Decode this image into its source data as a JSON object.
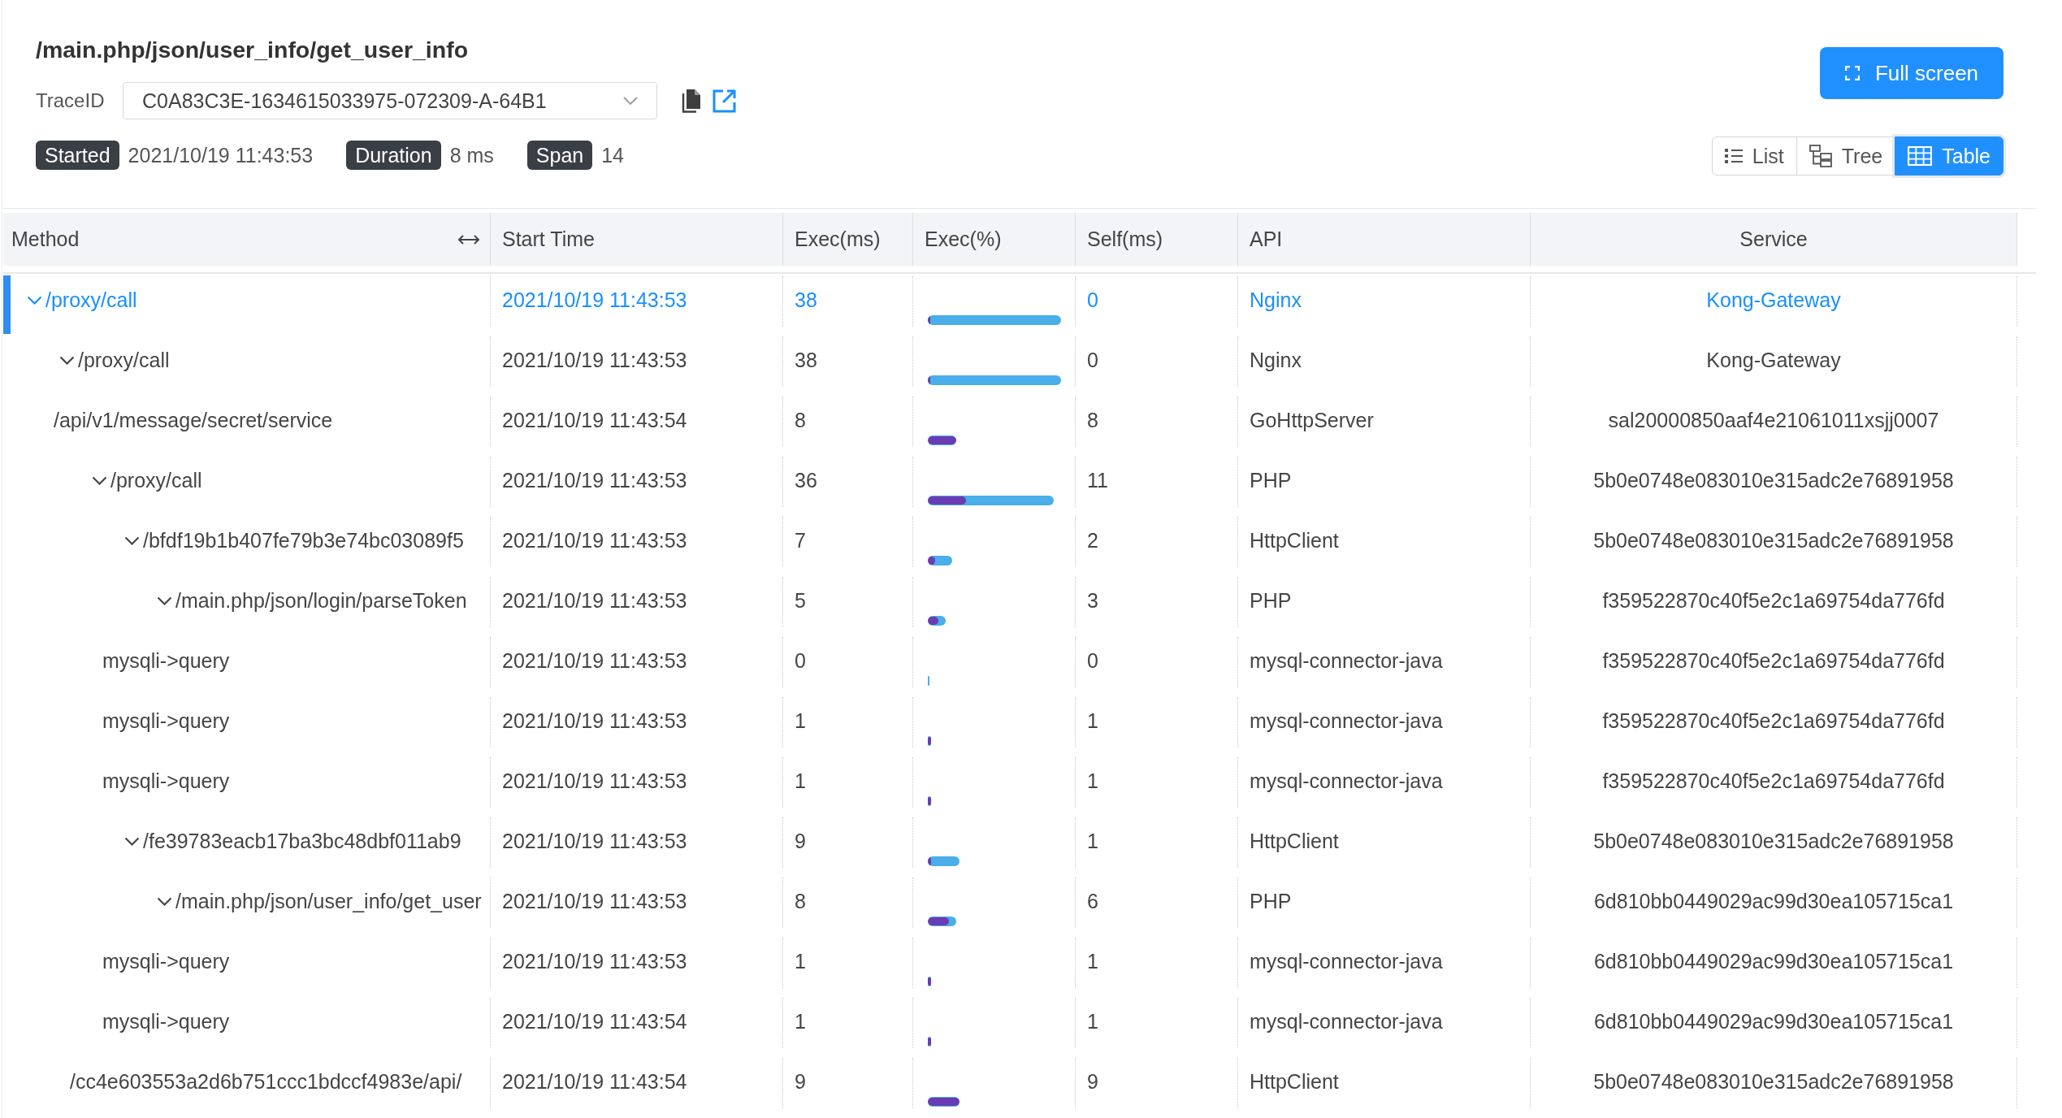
{
  "header": {
    "title": "/main.php/json/user_info/get_user_info",
    "trace_label": "TraceID",
    "trace_id": "C0A83C3E-1634615033975-072309-A-64B1",
    "summary": [
      {
        "label": "Started",
        "value": "2021/10/19 11:43:53"
      },
      {
        "label": "Duration",
        "value": "8 ms"
      },
      {
        "label": "Span",
        "value": "14"
      }
    ],
    "fullscreen_button": "Full screen",
    "views": [
      {
        "label": "List",
        "kind": "list",
        "selected": false
      },
      {
        "label": "Tree",
        "kind": "tree",
        "selected": false
      },
      {
        "label": "Table",
        "kind": "table",
        "selected": true
      }
    ]
  },
  "table": {
    "columns": [
      {
        "label": "Method",
        "resizable": true
      },
      {
        "label": "Start Time",
        "resizable": false
      },
      {
        "label": "Exec(ms)",
        "resizable": false
      },
      {
        "label": "Exec(%)",
        "resizable": false
      },
      {
        "label": "Self(ms)",
        "resizable": false
      },
      {
        "label": "API",
        "resizable": false
      },
      {
        "label": "Service",
        "resizable": false
      }
    ],
    "rows": [
      {
        "method": "/proxy/call",
        "start_time": "2021/10/19 11:43:53",
        "exec_ms": "38",
        "self_ms": "0",
        "api": "Nginx",
        "service": "Kong-Gateway",
        "selected": true,
        "expanded": true,
        "children": [
          {
            "method": "/proxy/call",
            "start_time": "2021/10/19 11:43:53",
            "exec_ms": "38",
            "self_ms": "0",
            "api": "Nginx",
            "service": "Kong-Gateway",
            "selected": false,
            "expanded": true,
            "children": [
              {
                "method": "/api/v1/message/secret/service",
                "start_time": "2021/10/19 11:43:54",
                "exec_ms": "8",
                "self_ms": "8",
                "api": "GoHttpServer",
                "service": "sal20000850aaf4e21061011xsjj0007",
                "selected": false
              },
              {
                "method": "/proxy/call",
                "start_time": "2021/10/19 11:43:53",
                "exec_ms": "36",
                "self_ms": "11",
                "api": "PHP",
                "service": "5b0e0748e083010e315adc2e76891958",
                "selected": false,
                "expanded": true,
                "children": [
                  {
                    "method": "/bfdf19b1b407fe79b3e74bc03089f5",
                    "start_time": "2021/10/19 11:43:53",
                    "exec_ms": "7",
                    "self_ms": "2",
                    "api": "HttpClient",
                    "service": "5b0e0748e083010e315adc2e76891958",
                    "selected": false,
                    "expanded": true,
                    "children": [
                      {
                        "method": "/main.php/json/login/parseToken",
                        "start_time": "2021/10/19 11:43:53",
                        "exec_ms": "5",
                        "self_ms": "3",
                        "api": "PHP",
                        "service": "f359522870c40f5e2c1a69754da776fd",
                        "selected": false,
                        "expanded": true,
                        "children": [
                          {
                            "method": "mysqli->query",
                            "start_time": "2021/10/19 11:43:53",
                            "exec_ms": "0",
                            "self_ms": "0",
                            "api": "mysql-connector-java",
                            "service": "f359522870c40f5e2c1a69754da776fd",
                            "selected": false
                          },
                          {
                            "method": "mysqli->query",
                            "start_time": "2021/10/19 11:43:53",
                            "exec_ms": "1",
                            "self_ms": "1",
                            "api": "mysql-connector-java",
                            "service": "f359522870c40f5e2c1a69754da776fd",
                            "selected": false
                          },
                          {
                            "method": "mysqli->query",
                            "start_time": "2021/10/19 11:43:53",
                            "exec_ms": "1",
                            "self_ms": "1",
                            "api": "mysql-connector-java",
                            "service": "f359522870c40f5e2c1a69754da776fd",
                            "selected": false
                          }
                        ]
                      }
                    ]
                  },
                  {
                    "method": "/fe39783eacb17ba3bc48dbf011ab9",
                    "start_time": "2021/10/19 11:43:53",
                    "exec_ms": "9",
                    "self_ms": "1",
                    "api": "HttpClient",
                    "service": "5b0e0748e083010e315adc2e76891958",
                    "selected": false,
                    "expanded": true,
                    "children": [
                      {
                        "method": "/main.php/json/user_info/get_user",
                        "start_time": "2021/10/19 11:43:53",
                        "exec_ms": "8",
                        "self_ms": "6",
                        "api": "PHP",
                        "service": "6d810bb0449029ac99d30ea105715ca1",
                        "selected": false,
                        "expanded": true,
                        "children": [
                          {
                            "method": "mysqli->query",
                            "start_time": "2021/10/19 11:43:53",
                            "exec_ms": "1",
                            "self_ms": "1",
                            "api": "mysql-connector-java",
                            "service": "6d810bb0449029ac99d30ea105715ca1",
                            "selected": false
                          },
                          {
                            "method": "mysqli->query",
                            "start_time": "2021/10/19 11:43:54",
                            "exec_ms": "1",
                            "self_ms": "1",
                            "api": "mysql-connector-java",
                            "service": "6d810bb0449029ac99d30ea105715ca1",
                            "selected": false
                          }
                        ]
                      }
                    ]
                  },
                  {
                    "method": "/cc4e603553a2d6b751ccc1bdccf4983e/api/",
                    "start_time": "2021/10/19 11:43:54",
                    "exec_ms": "9",
                    "self_ms": "9",
                    "api": "HttpClient",
                    "service": "5b0e0748e083010e315adc2e76891958",
                    "selected": false
                  }
                ]
              }
            ]
          }
        ]
      }
    ]
  }
}
